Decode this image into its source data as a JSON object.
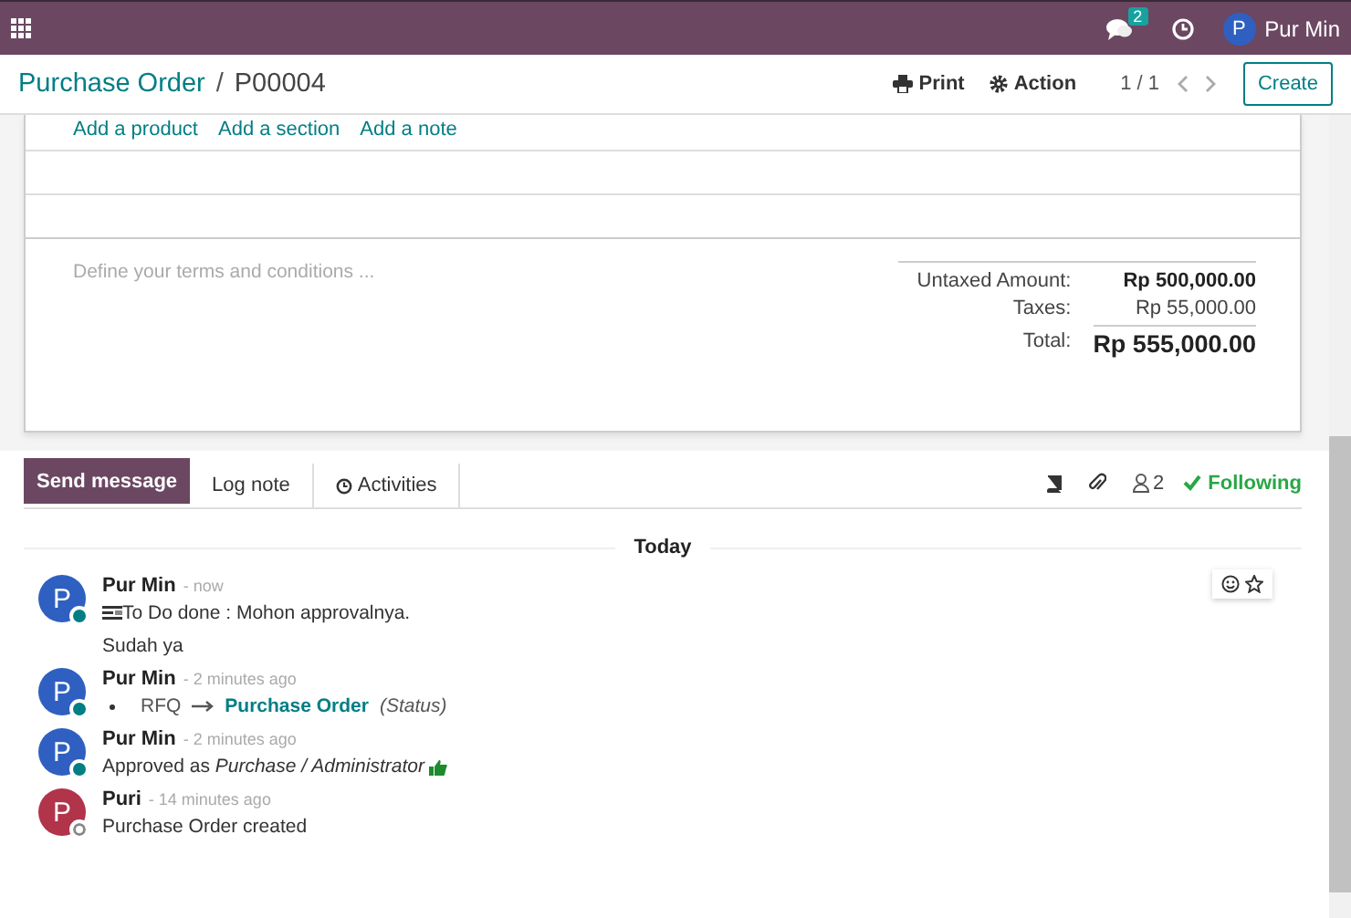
{
  "navbar": {
    "messages_badge": "2",
    "user_initial": "P",
    "user_name": "Pur Min"
  },
  "breadcrumb": {
    "parent": "Purchase Order",
    "separator": "/",
    "current": "P00004"
  },
  "control_panel": {
    "print": "Print",
    "action": "Action",
    "pager": "1 / 1",
    "create": "Create"
  },
  "order_lines": {
    "links": [
      "Add a product",
      "Add a section",
      "Add a note"
    ]
  },
  "terms": {
    "placeholder": "Define your terms and conditions ..."
  },
  "totals": [
    {
      "label": "Untaxed Amount:",
      "value": "Rp 500,000.00",
      "kind": "subtotal"
    },
    {
      "label": "Taxes:",
      "value": "Rp 55,000.00",
      "kind": "tax"
    },
    {
      "label": "Total:",
      "value": "Rp 555,000.00",
      "kind": "total"
    }
  ],
  "chatter": {
    "tabs": [
      {
        "label": "Send message",
        "kind": "primary"
      },
      {
        "label": "Log note",
        "kind": "tab"
      },
      {
        "label": "Activities",
        "kind": "activities"
      }
    ],
    "followers_count": "2",
    "following": "Following"
  },
  "date_separator": "Today",
  "messages": [
    {
      "author": "Pur Min",
      "time": "- now",
      "avatar_initial": "P",
      "color": "#2f60c1",
      "online": true,
      "hovered": true,
      "kind": "activity",
      "lines": [
        "To Do done : Mohon approvalnya.",
        "Sudah ya"
      ]
    },
    {
      "author": "Pur Min",
      "time": "- 2 minutes ago",
      "avatar_initial": "P",
      "color": "#2f60c1",
      "online": true,
      "hovered": false,
      "kind": "tracking",
      "old": "RFQ",
      "new": "Purchase Order",
      "field": "(Status)"
    },
    {
      "author": "Pur Min",
      "time": "- 2 minutes ago",
      "avatar_initial": "P",
      "color": "#2f60c1",
      "online": true,
      "hovered": false,
      "kind": "approval",
      "body": "Approved as *Purchase / Administrator*"
    },
    {
      "author": "Puri",
      "time": "- 14 minutes ago",
      "avatar_initial": "P",
      "color": "#b1344b",
      "online": false,
      "hovered": false,
      "kind": "text",
      "body": "Purchase Order created"
    }
  ]
}
